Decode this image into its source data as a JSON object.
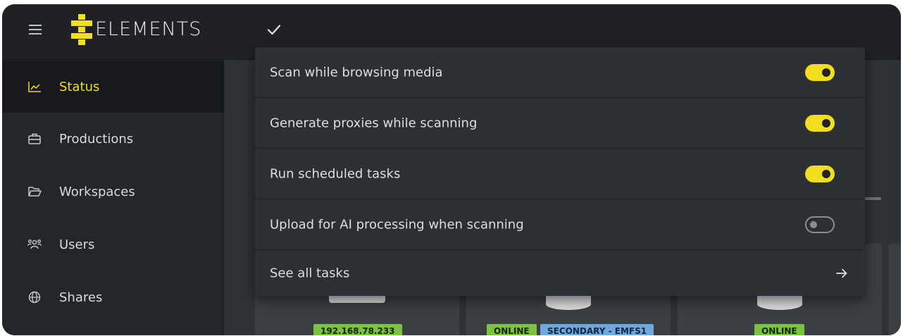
{
  "app": {
    "logo_text": "ELEMENTS"
  },
  "sidebar": {
    "items": [
      {
        "label": "Status",
        "icon": "chart-area-icon",
        "active": true
      },
      {
        "label": "Productions",
        "icon": "briefcase-icon",
        "active": false
      },
      {
        "label": "Workspaces",
        "icon": "folder-open-icon",
        "active": false
      },
      {
        "label": "Users",
        "icon": "users-icon",
        "active": false
      },
      {
        "label": "Shares",
        "icon": "globe-icon",
        "active": false
      }
    ]
  },
  "menu": {
    "items": [
      {
        "label": "Scan while browsing media",
        "toggle": "on"
      },
      {
        "label": "Generate proxies while scanning",
        "toggle": "on"
      },
      {
        "label": "Run scheduled tasks",
        "toggle": "on"
      },
      {
        "label": "Upload for AI processing when scanning",
        "toggle": "off"
      }
    ],
    "see_all": "See all tasks"
  },
  "cards": {
    "badges": [
      {
        "text": "192.168.78.233",
        "color": "green"
      },
      {
        "text": "ONLINE",
        "color": "green"
      },
      {
        "text": "SECONDARY - EMFS1",
        "color": "blue"
      },
      {
        "text": "ONLINE",
        "color": "green"
      }
    ]
  },
  "colors": {
    "accent": "#f2dd1f",
    "background": "#2f3236",
    "topbar": "#1f2124",
    "sidebar": "#23262a"
  }
}
